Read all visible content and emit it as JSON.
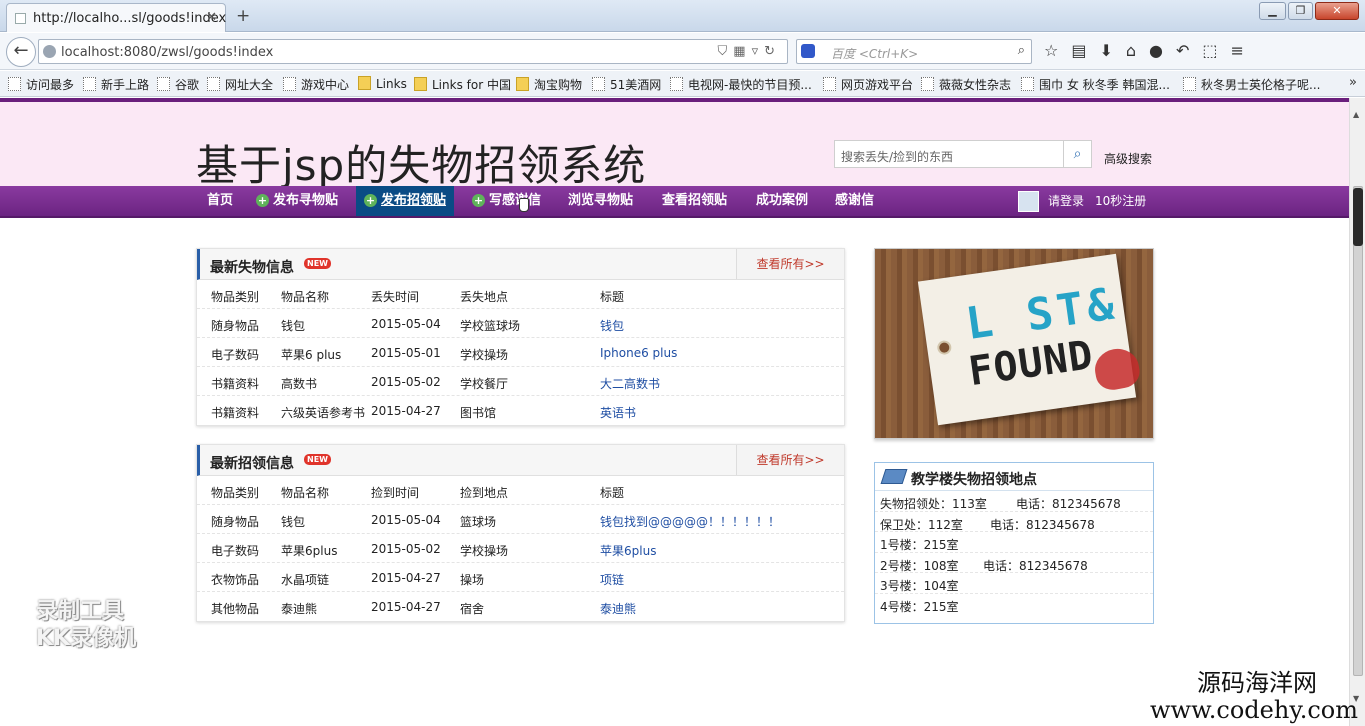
{
  "browser": {
    "tab_title": "http://localho...sl/goods!index",
    "new_tab": "+",
    "url": "localhost:8080/zwsl/goods!index",
    "search_placeholder": "百度 <Ctrl+K>",
    "window_buttons": [
      "minimize",
      "maximize",
      "close"
    ],
    "bookmarks": [
      {
        "label": "访问最多",
        "type": "page"
      },
      {
        "label": "新手上路",
        "type": "page"
      },
      {
        "label": "谷歌",
        "type": "page"
      },
      {
        "label": "网址大全",
        "type": "page"
      },
      {
        "label": "游戏中心",
        "type": "page"
      },
      {
        "label": "Links",
        "type": "folder"
      },
      {
        "label": "Links for 中国",
        "type": "folder"
      },
      {
        "label": "淘宝购物",
        "type": "folder"
      },
      {
        "label": "51美酒网",
        "type": "page"
      },
      {
        "label": "电视网-最快的节目预...",
        "type": "page"
      },
      {
        "label": "网页游戏平台",
        "type": "page"
      },
      {
        "label": "薇薇女性杂志",
        "type": "page"
      },
      {
        "label": "围巾 女 秋冬季 韩国混...",
        "type": "page"
      },
      {
        "label": "秋冬男士英伦格子呢...",
        "type": "page"
      }
    ],
    "bookmarks_more": "»"
  },
  "site": {
    "title": "基于jsp的失物招领系统",
    "search_placeholder": "搜索丢失/捡到的东西",
    "advanced_search": "高级搜索",
    "nav": [
      {
        "label": "首页",
        "plus": false
      },
      {
        "label": "发布寻物贴",
        "plus": true
      },
      {
        "label": "发布招领贴",
        "plus": true,
        "active": true
      },
      {
        "label": "写感谢信",
        "plus": true
      },
      {
        "label": "浏览寻物贴",
        "plus": false
      },
      {
        "label": "查看招领贴",
        "plus": false
      },
      {
        "label": "成功案例",
        "plus": false
      },
      {
        "label": "感谢信",
        "plus": false
      }
    ],
    "login": "请登录",
    "register": "10秒注册"
  },
  "lost": {
    "title": "最新失物信息",
    "badge": "NEW",
    "view_all": "查看所有>>",
    "headers": [
      "物品类别",
      "物品名称",
      "丢失时间",
      "丢失地点",
      "标题"
    ],
    "rows": [
      [
        "随身物品",
        "钱包",
        "2015-05-04",
        "学校篮球场",
        "钱包"
      ],
      [
        "电子数码",
        "苹果6 plus",
        "2015-05-01",
        "学校操场",
        "Iphone6 plus"
      ],
      [
        "书籍资料",
        "高数书",
        "2015-05-02",
        "学校餐厅",
        "大二高数书"
      ],
      [
        "书籍资料",
        "六级英语参考书",
        "2015-04-27",
        "图书馆",
        "英语书"
      ]
    ]
  },
  "found": {
    "title": "最新招领信息",
    "badge": "NEW",
    "view_all": "查看所有>>",
    "headers": [
      "物品类别",
      "物品名称",
      "捡到时间",
      "捡到地点",
      "标题"
    ],
    "rows": [
      [
        "随身物品",
        "钱包",
        "2015-05-04",
        "篮球场",
        "钱包找到@@@@@！！！！！！"
      ],
      [
        "电子数码",
        "苹果6plus",
        "2015-05-02",
        "学校操场",
        "苹果6plus"
      ],
      [
        "衣物饰品",
        "水晶项链",
        "2015-04-27",
        "操场",
        "项链"
      ],
      [
        "其他物品",
        "泰迪熊",
        "2015-04-27",
        "宿舍",
        "泰迪熊"
      ]
    ]
  },
  "banner": {
    "line1": "L ST&",
    "line2": "FOUND"
  },
  "info": {
    "title": "教学楼失物招领地点",
    "rows": [
      {
        "a": "失物招领处：113室",
        "b": "电话：812345678"
      },
      {
        "a": "保卫处：112室",
        "b": "电话：812345678"
      },
      {
        "a": "1号楼：215室",
        "b": ""
      },
      {
        "a": "2号楼：108室",
        "b": "电话：812345678"
      },
      {
        "a": "3号楼：104室",
        "b": ""
      },
      {
        "a": "4号楼：215室",
        "b": ""
      }
    ]
  },
  "watermarks": {
    "left_line1": "录制工具",
    "left_line2": "KK录像机",
    "right_line1": "源码海洋网",
    "right_line2": "www.codehy.com"
  },
  "colors": {
    "nav_bg": "#7a2e91",
    "nav_active": "#0a4b85",
    "header_bg": "#fbe8f5",
    "link": "#1f4ea3",
    "view_all": "#c0392b"
  }
}
